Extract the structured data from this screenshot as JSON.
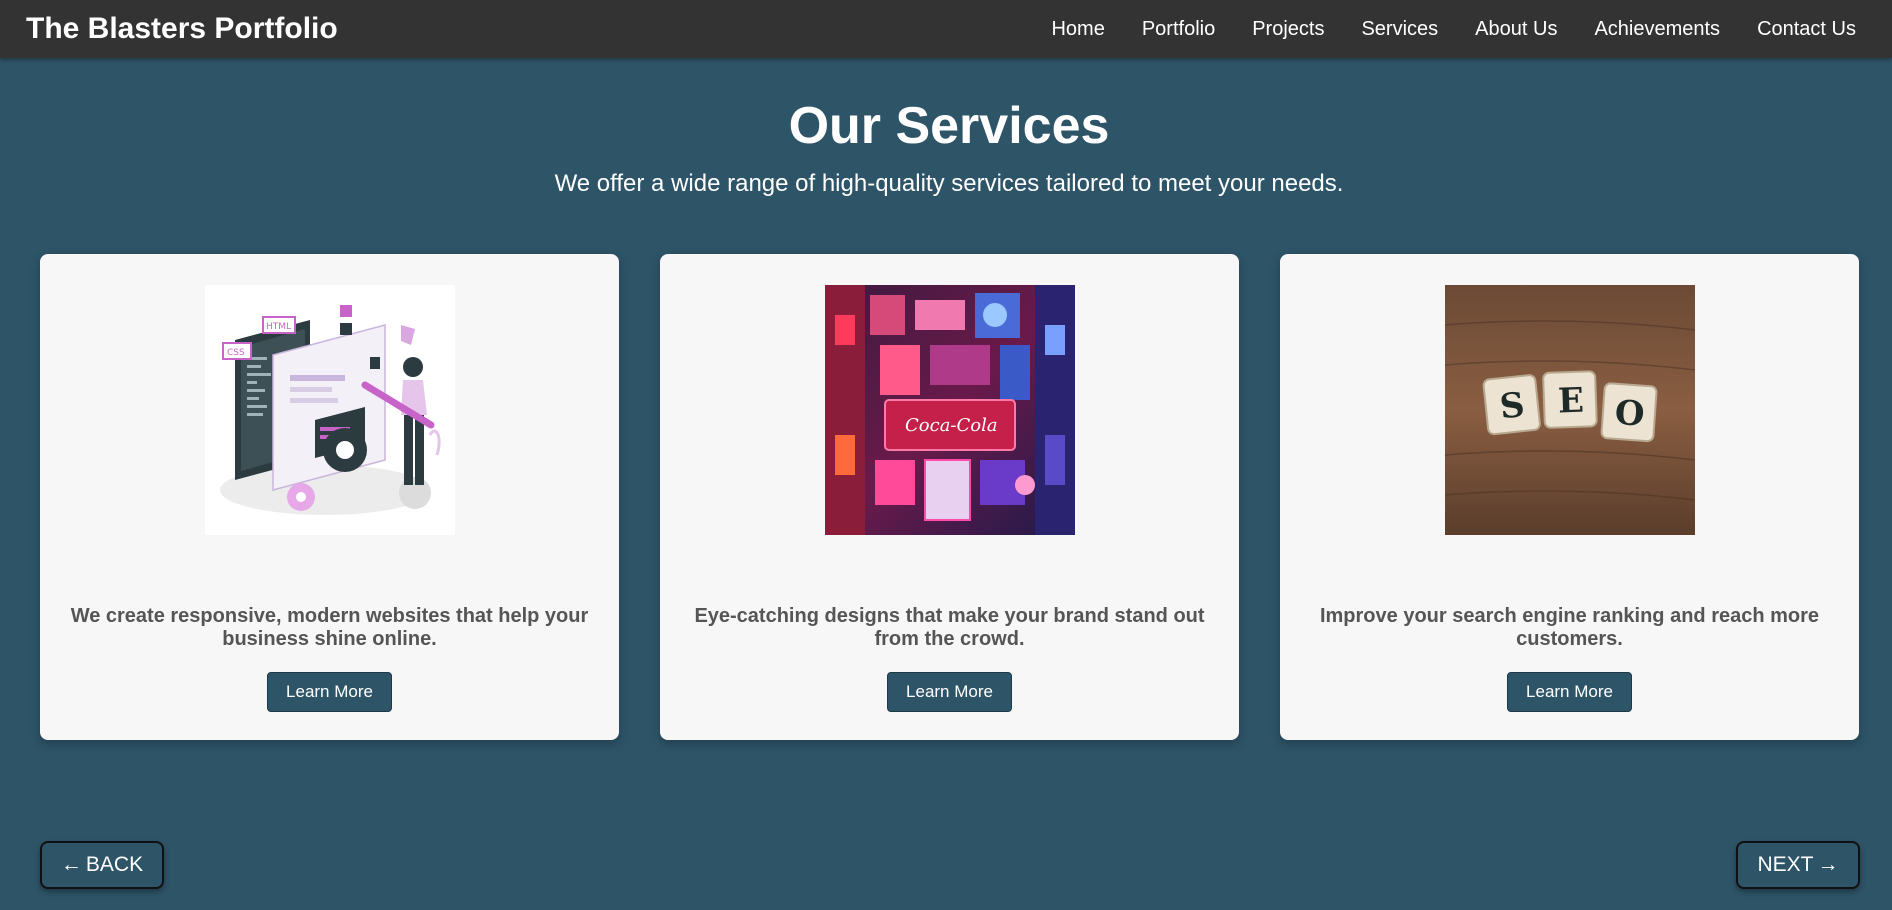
{
  "header": {
    "brand": "The Blasters Portfolio",
    "nav": [
      "Home",
      "Portfolio",
      "Projects",
      "Services",
      "About Us",
      "Achievements",
      "Contact Us"
    ]
  },
  "hero": {
    "title": "Our Services",
    "subtitle": "We offer a wide range of high-quality services tailored to meet your needs."
  },
  "cards": [
    {
      "image_icon": "web-development-illustration-icon",
      "description": "We create responsive, modern websites that help your business shine online.",
      "button": "Learn More"
    },
    {
      "image_icon": "neon-signs-design-image",
      "description": "Eye-catching designs that make your brand stand out from the crowd.",
      "button": "Learn More"
    },
    {
      "image_icon": "seo-tiles-image",
      "description": "Improve your search engine ranking and reach more customers.",
      "button": "Learn More"
    }
  ],
  "footer_nav": {
    "back_arrow": "←",
    "back_label": "BACK",
    "next_label": "NEXT",
    "next_arrow": "→"
  },
  "colors": {
    "background": "#2e5468",
    "navbar": "#333333",
    "card": "#f7f7f7",
    "card_text": "#555555"
  }
}
